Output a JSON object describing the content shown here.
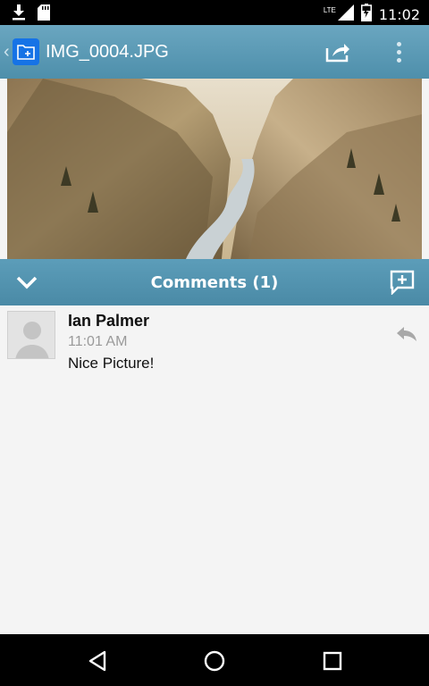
{
  "status_bar": {
    "time": "11:02",
    "network": "LTE",
    "icons": [
      "download-icon",
      "sd-card-icon",
      "signal-icon",
      "battery-icon"
    ]
  },
  "action_bar": {
    "title": "IMG_0004.JPG",
    "icons": [
      "back-caret-icon",
      "folder-icon",
      "share-icon",
      "overflow-menu-icon"
    ]
  },
  "comments_bar": {
    "title": "Comments (1)",
    "icons": [
      "chevron-down-icon",
      "add-comment-icon"
    ]
  },
  "comments": [
    {
      "author": "Ian Palmer",
      "time": "11:01 AM",
      "text": "Nice Picture!"
    }
  ],
  "nav_bar": {
    "icons": [
      "back-icon",
      "home-icon",
      "recents-icon"
    ]
  },
  "colors": {
    "action_bar": "#5b9ab5",
    "app_icon": "#1673e6",
    "background": "#f4f4f4"
  }
}
